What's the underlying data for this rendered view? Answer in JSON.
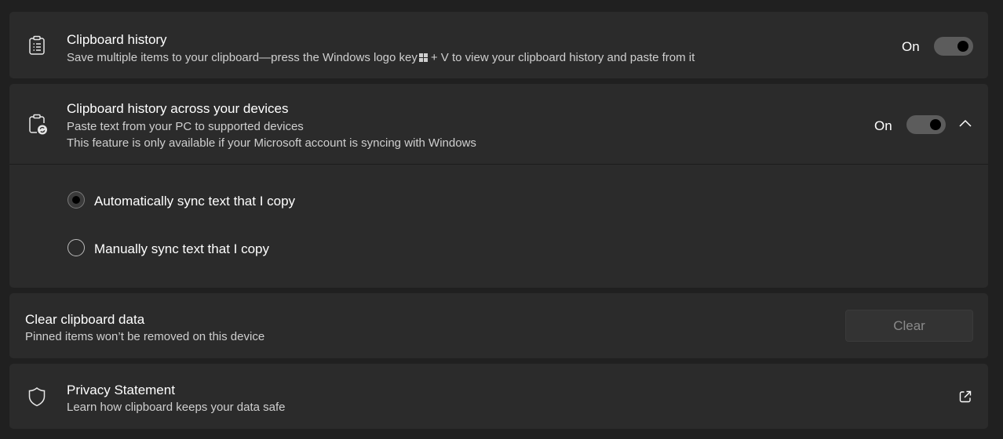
{
  "clipboard_history": {
    "title": "Clipboard history",
    "description_before_key": "Save multiple items to your clipboard—press the Windows logo key",
    "description_after_key": "+ V to view your clipboard history and paste from it",
    "state_label": "On",
    "toggle_on": true,
    "icon": "clipboard-list-icon"
  },
  "sync_devices": {
    "title": "Clipboard history across your devices",
    "description_line1": "Paste text from your PC to supported devices",
    "description_line2": "This feature is only available if your Microsoft account is syncing with Windows",
    "state_label": "On",
    "toggle_on": true,
    "expanded": true,
    "icon": "clipboard-sync-icon",
    "options": [
      {
        "label": "Automatically sync text that I copy",
        "selected": true
      },
      {
        "label": "Manually sync text that I copy",
        "selected": false
      }
    ]
  },
  "clear_data": {
    "title": "Clear clipboard data",
    "description": "Pinned items won’t be removed on this device",
    "button_label": "Clear",
    "button_enabled": false
  },
  "privacy": {
    "title": "Privacy Statement",
    "description": "Learn how clipboard keeps your data safe",
    "icon": "shield-icon",
    "link_icon": "external-link-icon"
  },
  "colors": {
    "background": "#202020",
    "card": "#2b2b2b",
    "text_primary": "#ffffff",
    "text_secondary": "#cfcfcf",
    "toggle_track": "#5c5c5c",
    "disabled_text": "#8a8a8a"
  }
}
